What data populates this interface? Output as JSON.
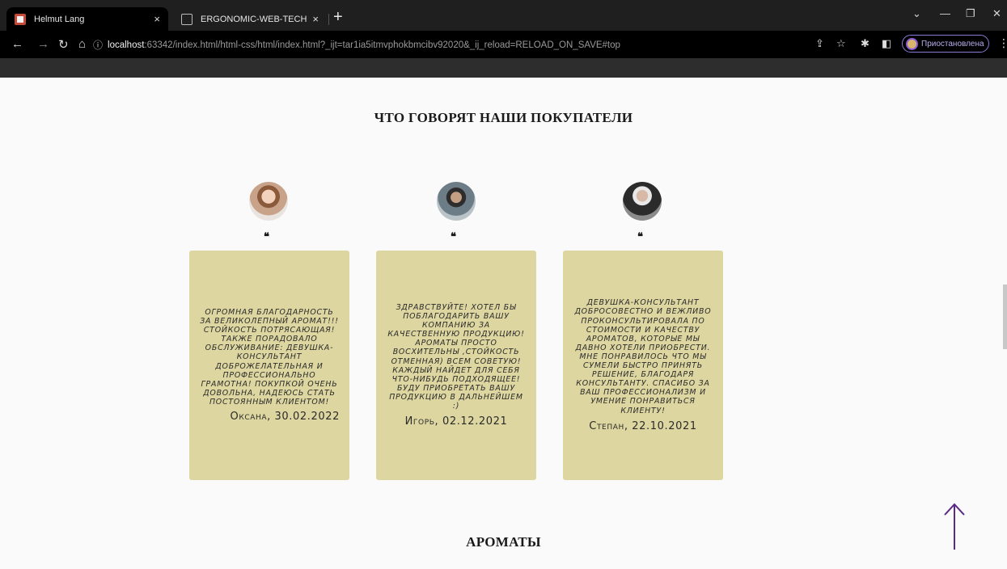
{
  "browser": {
    "tabs": [
      {
        "title": "Helmut Lang",
        "active": true
      },
      {
        "title": "ERGONOMIC-WEB-TECHNOLOG",
        "active": false
      }
    ],
    "address": {
      "host": "localhost",
      "rest": ":63342/index.html/html-css/html/index.html?_ijt=tar1ia5itmvphokbmcibv92020&_ij_reload=RELOAD_ON_SAVE#top"
    },
    "profile_status": "Приостановлена"
  },
  "page": {
    "reviews_title": "ЧТО ГОВОРЯТ НАШИ ПОКУПАТЕЛИ",
    "quote_mark": "❝",
    "reviews": [
      {
        "text": "Огромная благодарность за великолепный аромат!!! Стойкость потрясающая! Также порадовало обслуживание: девушка-консультант доброжелательная и профессионально грамотна! Покупкой очень довольна, надеюсь стать постоянным клиентом!",
        "author": "Оксана, 30.02.2022"
      },
      {
        "text": "Здравствуйте! Хотел бы поблагодарить вашу компанию за качественную продукцию! Ароматы просто восхительны ,стойкость отменная) Всем советую!каждый найдет для себя что-нибудь подходящее! Буду приобретать вашу продукцию в дальнейшем :)",
        "author": "Игорь, 02.12.2021"
      },
      {
        "text": "Девушка-консультант добросовестно и вежливо проконсультировала по стоимости и качеству ароматов, которые мы давно хотели приобрести. Мне понравилось что мы сумели быстро принять решение, благодаря консультанту. Спасибо за ваш профессионализм и умение понравиться клиенту!",
        "author": "Степан, 22.10.2021"
      }
    ],
    "aromas_title": "АРОМАТЫ"
  }
}
